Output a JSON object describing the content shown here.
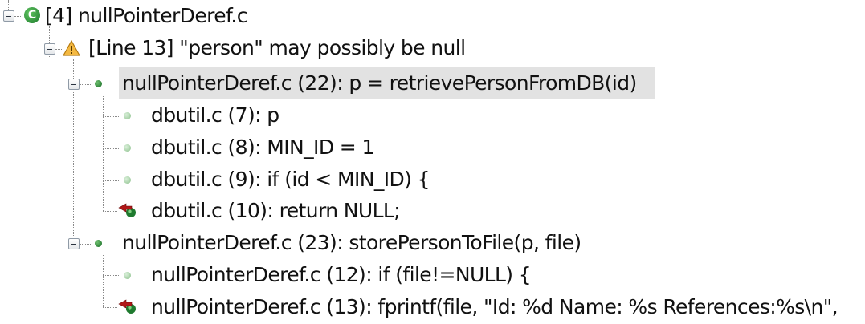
{
  "tree": {
    "file_node": {
      "label": "[4] nullPointerDeref.c",
      "icon": "c-source-file-icon"
    },
    "warning_node": {
      "label": "[Line 13] \"person\" may possibly be null",
      "icon": "warning-icon"
    },
    "trace_nodes": [
      {
        "label": "nullPointerDeref.c (22): p = retrievePersonFromDB(id)",
        "icon": "trace-step-icon",
        "selected": true
      },
      {
        "label": "dbutil.c (7): p",
        "icon": "trace-substep-icon"
      },
      {
        "label": "dbutil.c (8): MIN_ID = 1",
        "icon": "trace-substep-icon"
      },
      {
        "label": "dbutil.c (9): if (id < MIN_ID) {",
        "icon": "trace-substep-icon"
      },
      {
        "label": "dbutil.c (10): return NULL;",
        "icon": "return-arrow-icon"
      },
      {
        "label": "nullPointerDeref.c (23): storePersonToFile(p, file)",
        "icon": "trace-step-icon"
      },
      {
        "label": "nullPointerDeref.c (12): if (file!=NULL) {",
        "icon": "trace-substep-icon"
      },
      {
        "label": "nullPointerDeref.c (13): fprintf(file, \"Id: %d Name: %s References:%s\\n\",",
        "icon": "return-arrow-icon"
      }
    ]
  },
  "colors": {
    "selection": "#e2e2e2",
    "c_icon": "#2e9a3e",
    "warning": "#f0b020",
    "return_arrow": "#b01818"
  }
}
